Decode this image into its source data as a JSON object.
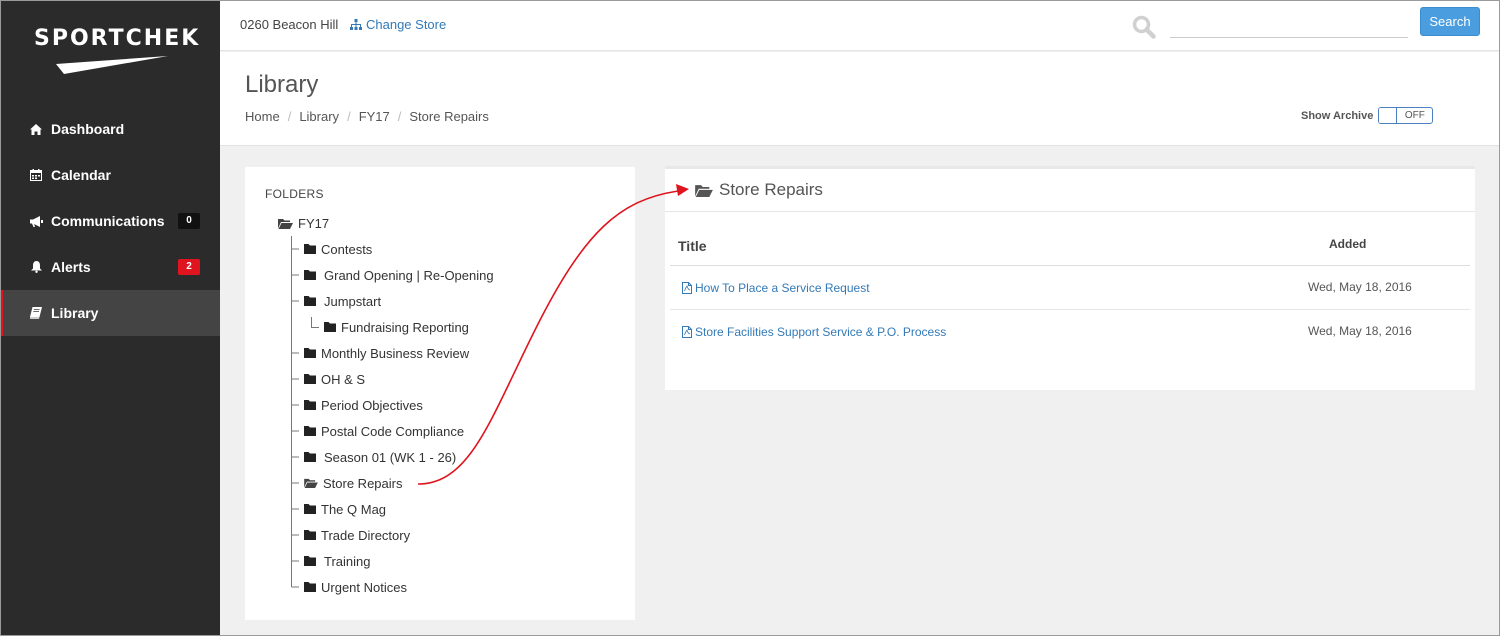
{
  "brand": {
    "name": "SPORTCHEK"
  },
  "sidebar": {
    "items": [
      {
        "label": "Dashboard",
        "icon": "home-icon"
      },
      {
        "label": "Calendar",
        "icon": "calendar-icon"
      },
      {
        "label": "Communications",
        "icon": "megaphone-icon",
        "badge": "0"
      },
      {
        "label": "Alerts",
        "icon": "bell-icon",
        "badge": "2"
      },
      {
        "label": "Library",
        "icon": "book-icon",
        "active": true
      }
    ],
    "accent_color": "#e0141e"
  },
  "topbar": {
    "store_name": "0260 Beacon Hill",
    "change_store_label": "Change Store",
    "search_placeholder": "",
    "search_button_label": "Search"
  },
  "header": {
    "title": "Library",
    "breadcrumb": [
      "Home",
      "Library",
      "FY17",
      "Store Repairs"
    ],
    "archive_label": "Show Archive",
    "archive_toggle": "OFF"
  },
  "folders": {
    "title": "FOLDERS",
    "root": "FY17",
    "items": [
      "Contests",
      "Grand Opening | Re-Opening",
      "Jumpstart",
      "Fundraising Reporting",
      "Monthly Business Review",
      "OH & S",
      "Period Objectives",
      "Postal Code Compliance",
      "Season 01 (WK 1 - 26)",
      "Store Repairs",
      "The Q Mag",
      "Trade Directory",
      "Training",
      "Urgent Notices"
    ]
  },
  "content": {
    "title": "Store Repairs",
    "columns": {
      "title": "Title",
      "added": "Added"
    },
    "rows": [
      {
        "title": "How To Place a Service Request",
        "added": "Wed, May 18, 2016"
      },
      {
        "title": "Store Facilities Support Service & P.O. Process",
        "added": "Wed, May 18, 2016"
      }
    ]
  }
}
